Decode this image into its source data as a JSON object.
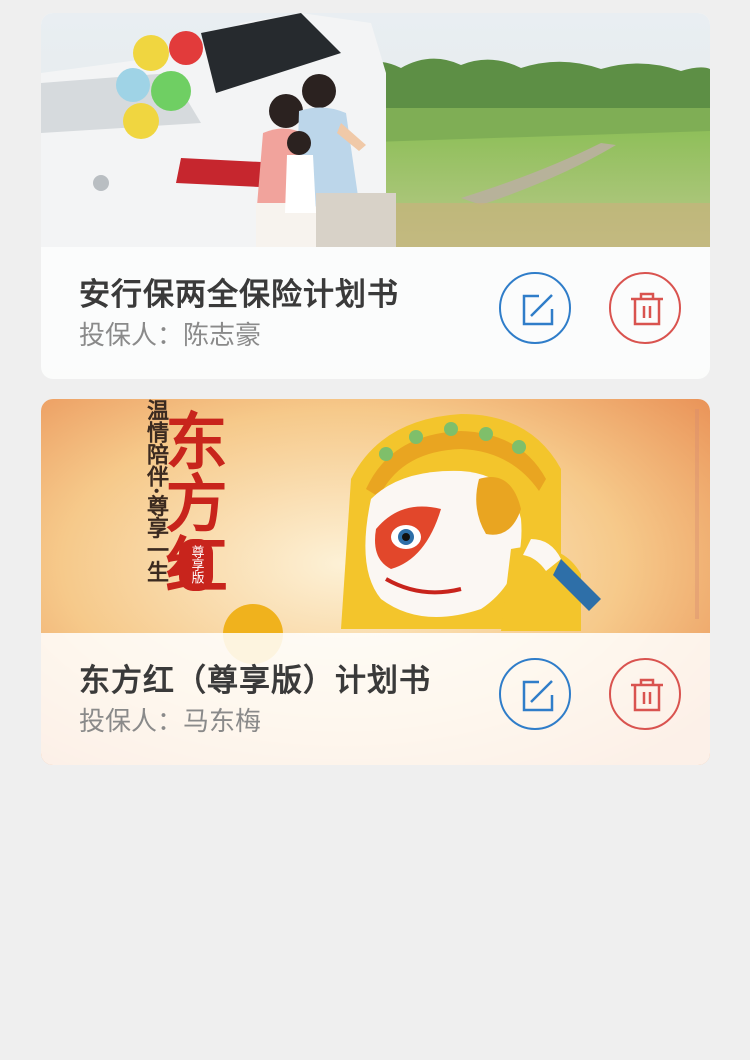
{
  "plans": [
    {
      "title": "安行保两全保险计划书",
      "insured_label": "投保人：",
      "insured_name": "陈志豪",
      "banner_icon": "family-car-photo"
    },
    {
      "title": "东方红（尊享版）计划书",
      "insured_label": "投保人：",
      "insured_name": "马东梅",
      "banner_icon": "dongfanghong-monkey-poster",
      "poster_text": {
        "headline": "东方红",
        "badge": "尊享版",
        "slogan": "温情陪伴·尊享一生"
      }
    }
  ],
  "actions": {
    "edit_icon": "edit-icon",
    "delete_icon": "trash-icon"
  },
  "colors": {
    "edit": "#2f7dc9",
    "delete": "#d9534f",
    "background": "#efefef",
    "title": "#3a3a3a",
    "subtitle": "#8a8a8a"
  }
}
